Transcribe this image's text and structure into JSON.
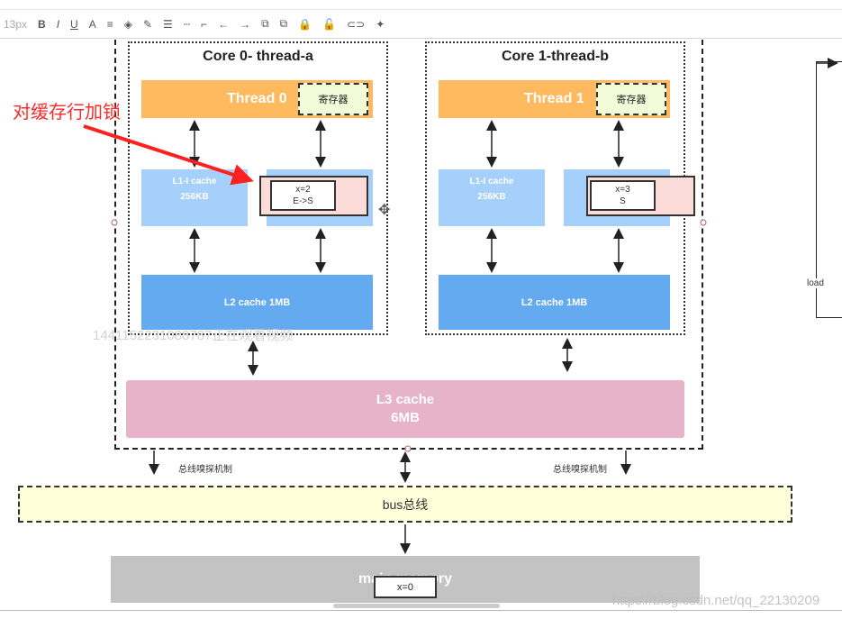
{
  "toolbar": {
    "font_size": "13px",
    "items": [
      "B",
      "I",
      "U",
      "A",
      "≡",
      "◈",
      "✎",
      "☰",
      "┄",
      "⌐",
      "←",
      "→",
      "⧉",
      "⧉",
      "🔒",
      "🔓",
      "⊂⊃",
      "✦"
    ]
  },
  "annotation": {
    "text": "对缓存行加锁",
    "color": "#ff2a2a"
  },
  "core0": {
    "title": "Core 0- thread-a",
    "thread": "Thread 0",
    "register": "寄存器",
    "l1i_line1": "L1-I cache",
    "l1i_line2": "256KB",
    "cache_line1": "x=2",
    "cache_line2": "E->S",
    "l2": "L2 cache 1MB"
  },
  "core1": {
    "title": "Core 1-thread-b",
    "thread": "Thread 1",
    "register": "寄存器",
    "l1i_line1": "L1-I cache",
    "l1i_line2": "256KB",
    "cache_line1": "x=3",
    "cache_line2": "S",
    "l2": "L2 cache 1MB"
  },
  "l3": {
    "line1": "L3 cache",
    "line2": "6MB"
  },
  "snoop_left": "总线嗅探机制",
  "snoop_right": "总线嗅探机制",
  "bus": "bus总线",
  "memory": {
    "label": "main memory",
    "value": "x=0"
  },
  "side_label": "load",
  "watermark_viewer": "1441152231088787正在观看视频",
  "watermark_url": "https://blog.csdn.net/qq_22130209",
  "colors": {
    "thread": "#ffb95e",
    "l1": "#a6d0fc",
    "l2": "#63aaf0",
    "l3": "#e6b3c8",
    "bus": "#ffffd9",
    "memory": "#c3c3c3",
    "cacheline": "#fcdcd8",
    "register": "#f3fcd8"
  }
}
